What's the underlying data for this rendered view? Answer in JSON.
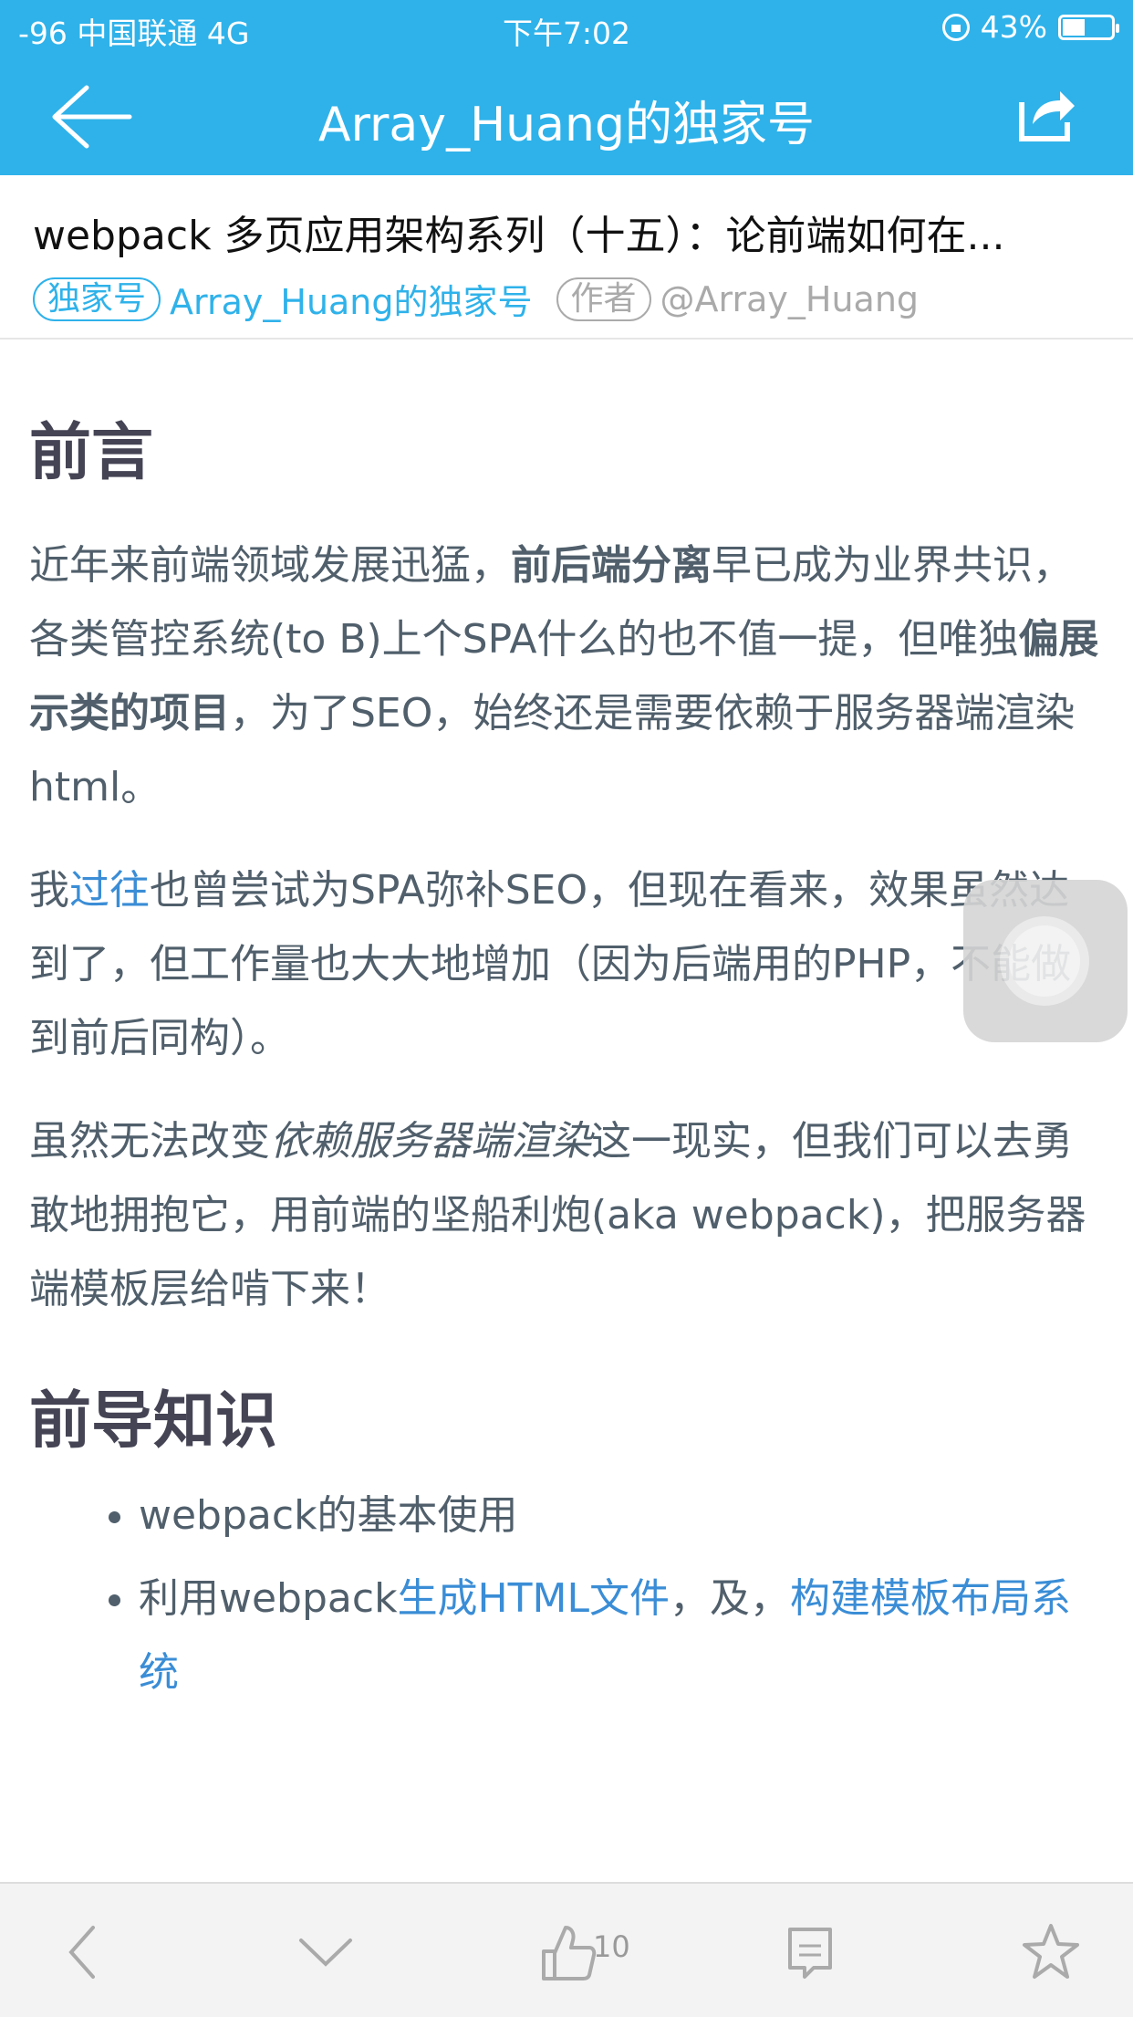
{
  "status": {
    "carrier": "-96 中国联通  4G",
    "time": "下午7:02",
    "battery": "43%",
    "battery_level": 0.43
  },
  "nav": {
    "title": "Array_Huang的独家号"
  },
  "article": {
    "title": "webpack 多页应用架构系列（十五）：论前端如何在...",
    "tag": "独家号",
    "channel": "Array_Huang的独家号",
    "author_tag": "作者",
    "author": "@Array_Huang"
  },
  "content": {
    "h1": "前言",
    "p1": {
      "a": "近年来前端领域发展迅猛，",
      "b": "前后端分离",
      "c": "早已成为业界共识，各类管控系统(to B)上个SPA什么的也不值一提，但唯独",
      "d": "偏展示类的项目",
      "e": "，为了SEO，始终还是需要依赖于服务器端渲染html。"
    },
    "p2": {
      "a": "我",
      "link": "过往",
      "b": "也曾尝试为SPA弥补SEO，但现在看来，效果虽然达到了，但工作量也大大地增加（因为后端用的PHP，不能做到前后同构）。"
    },
    "p3": {
      "a": "虽然无法改变",
      "em": "依赖服务器端渲染",
      "b": "这一现实，但我们可以去勇敢地拥抱它，用前端的坚船利炮(aka webpack)，把服务器端模板层给啃下来！"
    },
    "h2": "前导知识",
    "li1": "webpack的基本使用",
    "li2": {
      "a": "利用webpack",
      "link1": "生成HTML文件",
      "b": "，及，",
      "link2": "构建模板布局系统"
    }
  },
  "toolbar": {
    "like_count": "10"
  },
  "colors": {
    "accent": "#2fb2ea",
    "link": "#3a8dd6"
  }
}
